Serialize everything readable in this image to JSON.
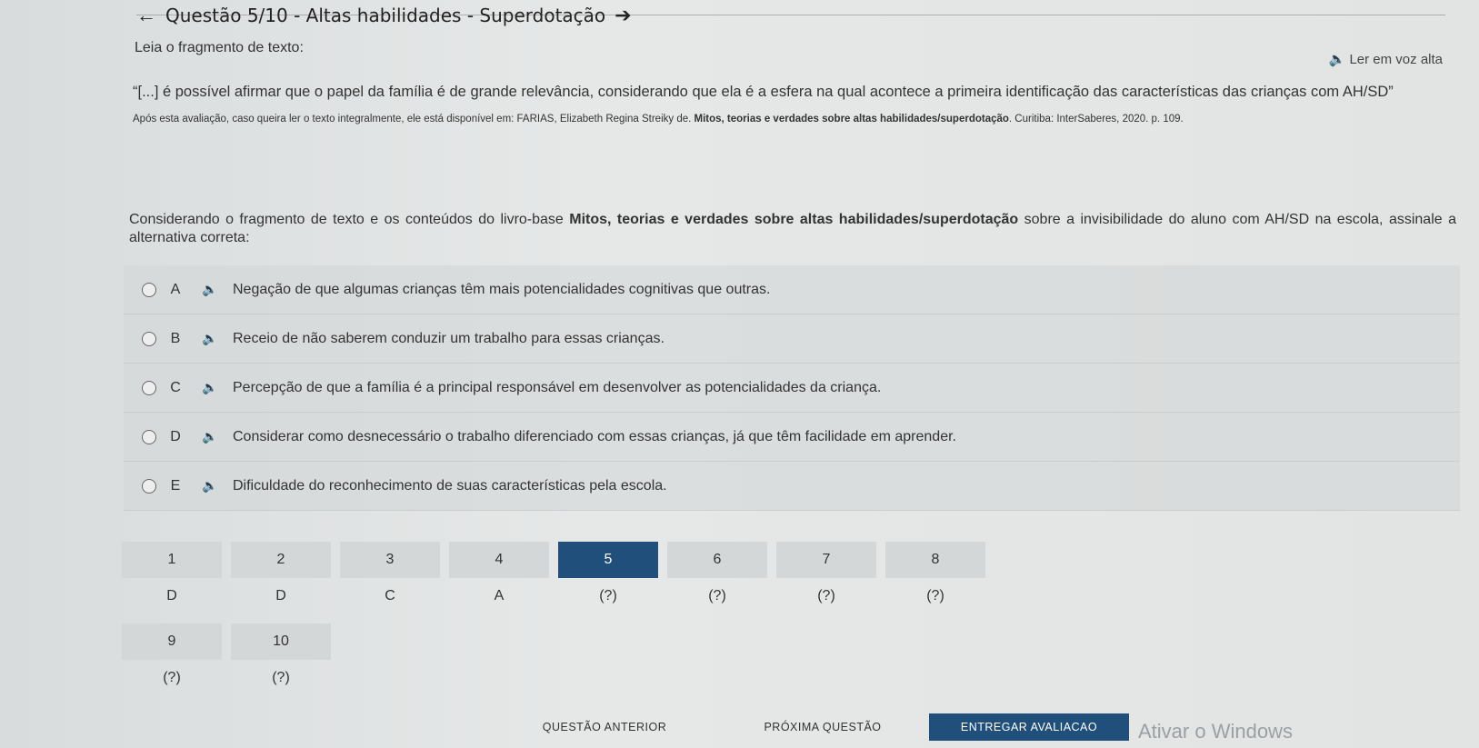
{
  "header": {
    "title": "Questão 5/10 - Altas habilidades - Superdotação"
  },
  "content": {
    "read_label": "Leia o fragmento de texto:",
    "read_aloud": "Ler em voz alta",
    "quote": "“[...] é possível afirmar que o papel da família é de grande relevância, considerando que ela é a esfera na qual acontece a primeira identificação das características das crianças com AH/SD”",
    "ref_part1": "Após esta avaliação, caso queira ler o texto integralmente, ele está disponível em: FARIAS, Elizabeth Regina Streiky de. ",
    "ref_bold": "Mitos, teorias e verdades sobre altas habilidades/superdotação",
    "ref_part2": ". Curitiba: InterSaberes, 2020. p. 109.",
    "question_part1": "Considerando o fragmento de texto e os conteúdos do livro-base ",
    "question_bold": "Mitos, teorias e verdades sobre altas habilidades/superdotação",
    "question_part2": " sobre a invisibilidade do aluno com AH/SD na escola, assinale a alternativa correta:"
  },
  "options": [
    {
      "letter": "A",
      "text": "Negação de que algumas crianças têm mais potencialidades cognitivas que outras."
    },
    {
      "letter": "B",
      "text": "Receio de não saberem conduzir um trabalho para essas crianças."
    },
    {
      "letter": "C",
      "text": "Percepção de que a família é a principal responsável em desenvolver as potencialidades da criança."
    },
    {
      "letter": "D",
      "text": "Considerar como desnecessário o trabalho diferenciado com essas crianças, já que têm facilidade em aprender."
    },
    {
      "letter": "E",
      "text": "Dificuldade do reconhecimento de suas características pela escola."
    }
  ],
  "navigation": [
    {
      "num": "1",
      "answer": "D"
    },
    {
      "num": "2",
      "answer": "D"
    },
    {
      "num": "3",
      "answer": "C"
    },
    {
      "num": "4",
      "answer": "A"
    },
    {
      "num": "5",
      "answer": "(?)"
    },
    {
      "num": "6",
      "answer": "(?)"
    },
    {
      "num": "7",
      "answer": "(?)"
    },
    {
      "num": "8",
      "answer": "(?)"
    },
    {
      "num": "9",
      "answer": "(?)"
    },
    {
      "num": "10",
      "answer": "(?)"
    }
  ],
  "buttons": {
    "prev": "QUESTÃO ANTERIOR",
    "next": "PRÓXIMA QUESTÃO",
    "submit": "ENTREGAR AVALIACAO"
  },
  "watermark": "Ativar o Windows",
  "colors": {
    "accent": "#1f4f7a"
  }
}
